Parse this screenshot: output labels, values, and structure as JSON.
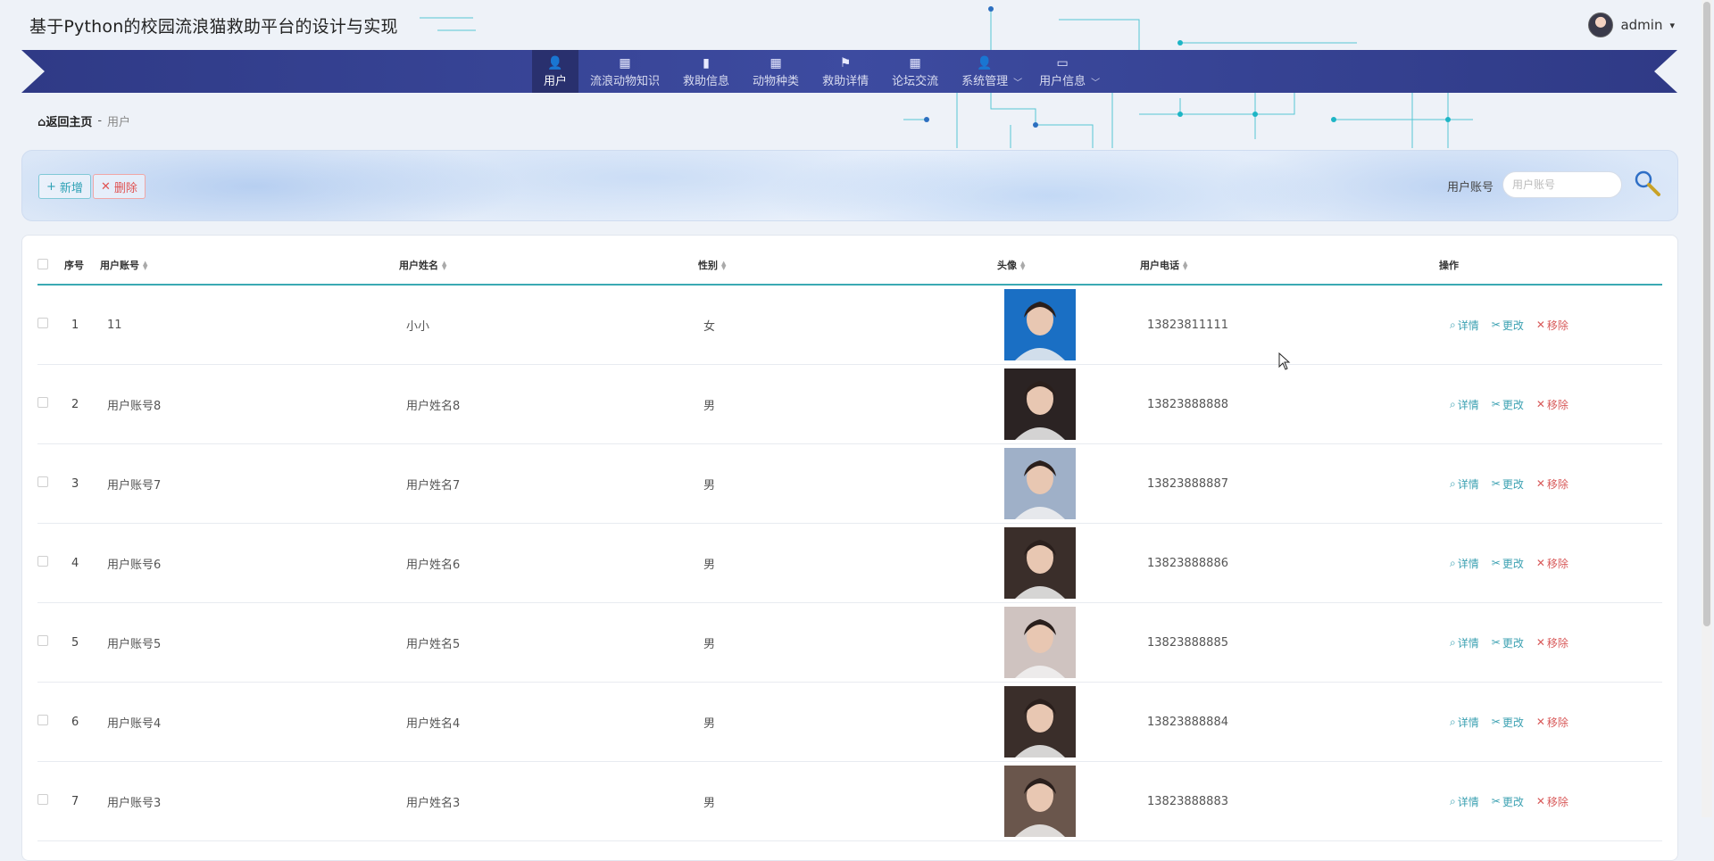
{
  "app": {
    "title": "基于Python的校园流浪猫救助平台的设计与实现"
  },
  "user_menu": {
    "username": "admin",
    "caret": "▾"
  },
  "nav": {
    "items": [
      {
        "label": "用户",
        "icon": "person-icon",
        "glyph": "👤",
        "active": true
      },
      {
        "label": "流浪动物知识",
        "icon": "grid-icon",
        "glyph": "▦"
      },
      {
        "label": "救助信息",
        "icon": "bar-chart-icon",
        "glyph": "▮"
      },
      {
        "label": "动物种类",
        "icon": "grid-icon",
        "glyph": "▦"
      },
      {
        "label": "救助详情",
        "icon": "flag-icon",
        "glyph": "⚑"
      },
      {
        "label": "论坛交流",
        "icon": "grid-icon",
        "glyph": "▦"
      },
      {
        "label": "系统管理",
        "icon": "person-icon",
        "glyph": "👤",
        "has_dropdown": true
      },
      {
        "label": "用户信息",
        "icon": "card-icon",
        "glyph": "▭",
        "has_dropdown": true
      }
    ]
  },
  "breadcrumb": {
    "home": "返回主页",
    "sep": "-",
    "current": "用户"
  },
  "toolbar": {
    "add_label": "新增",
    "add_glyph": "+",
    "delete_label": "删除",
    "delete_glyph": "✕",
    "search_label": "用户账号",
    "search_placeholder": "用户账号"
  },
  "table": {
    "columns": [
      "序号",
      "用户账号",
      "用户姓名",
      "性别",
      "头像",
      "用户电话",
      "操作"
    ],
    "rows": [
      {
        "index": "1",
        "account": "11",
        "name": "小小",
        "gender": "女",
        "phone": "13823811111",
        "photo_color": "#1a6fc4"
      },
      {
        "index": "2",
        "account": "用户账号8",
        "name": "用户姓名8",
        "gender": "男",
        "phone": "13823888888",
        "photo_color": "#2b2323"
      },
      {
        "index": "3",
        "account": "用户账号7",
        "name": "用户姓名7",
        "gender": "男",
        "phone": "13823888887",
        "photo_color": "#9fb0c8"
      },
      {
        "index": "4",
        "account": "用户账号6",
        "name": "用户姓名6",
        "gender": "男",
        "phone": "13823888886",
        "photo_color": "#3a2e2a"
      },
      {
        "index": "5",
        "account": "用户账号5",
        "name": "用户姓名5",
        "gender": "男",
        "phone": "13823888885",
        "photo_color": "#cfc3c0"
      },
      {
        "index": "6",
        "account": "用户账号4",
        "name": "用户姓名4",
        "gender": "男",
        "phone": "13823888884",
        "photo_color": "#3a2e2a"
      },
      {
        "index": "7",
        "account": "用户账号3",
        "name": "用户姓名3",
        "gender": "男",
        "phone": "13823888883",
        "photo_color": "#6a564c"
      }
    ],
    "ops": {
      "detail": "详情",
      "edit": "更改",
      "remove": "移除"
    }
  }
}
